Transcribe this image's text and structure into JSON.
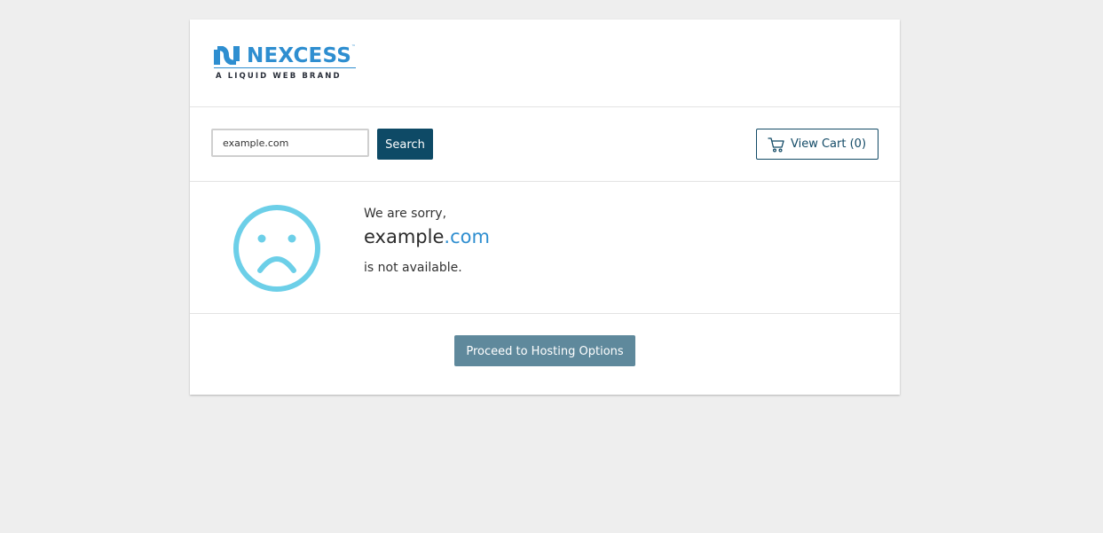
{
  "brand": {
    "name": "NEXCESS",
    "tagline": "A LIQUID WEB BRAND",
    "trademark": "™",
    "color": "#2e8ed0"
  },
  "search": {
    "value": "example.com",
    "button_label": "Search"
  },
  "cart": {
    "label": "View Cart (0)",
    "icon": "cart-icon"
  },
  "result": {
    "icon": "sad-face-icon",
    "sorry_text": "We are sorry,",
    "domain_name": "example",
    "domain_tld": ".com",
    "status_text": "is not available.",
    "icon_color": "#6ccfe8"
  },
  "action": {
    "proceed_label": "Proceed to Hosting Options"
  }
}
